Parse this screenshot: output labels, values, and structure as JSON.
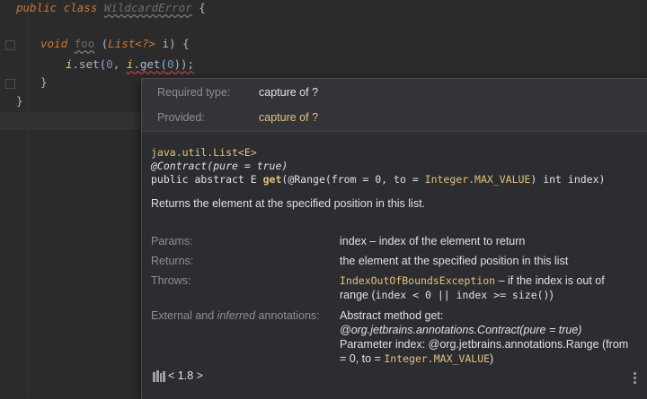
{
  "code": {
    "line1": {
      "kw_public": "public",
      "kw_class": "class",
      "class_name": "WildcardError",
      "brace": " {"
    },
    "line2": {
      "kw_void": "void",
      "method": "foo",
      "open": " (",
      "type": "List<?>",
      "param": " i) {"
    },
    "line3": {
      "var": "i",
      "call": ".set(",
      "n0": "0",
      "comma": ", ",
      "var2": "i",
      "get": ".get(",
      "n1": "0",
      "end": "));"
    },
    "line4": "}",
    "line5": "}"
  },
  "popup": {
    "required_label": "Required type:",
    "required_value": "capture of ?",
    "provided_label": "Provided:",
    "provided_value": "capture of ?",
    "sig_class": "java.util.List<E>",
    "sig_contract_prefix": "@Contract(pure = ",
    "sig_contract_value": "true",
    "sig_contract_suffix": ")",
    "sig_decl_prefix": "public abstract E ",
    "sig_method": "get",
    "sig_decl_mid": "(@Range(from = 0, to = ",
    "sig_max": "Integer.MAX_VALUE",
    "sig_decl_suffix": ") int index)",
    "description": "Returns the element at the specified position in this list.",
    "params_label": "Params:",
    "params_value": "index – index of the element to return",
    "returns_label": "Returns:",
    "returns_value": "the element at the specified position in this list",
    "throws_label": "Throws:",
    "throws_exception": "IndexOutOfBoundsException",
    "throws_text1": " – if the index is out of range (",
    "throws_code": "index < 0 || index >= size()",
    "throws_text2": ")",
    "ext_label_prefix": "External and ",
    "ext_label_italic": "inferred",
    "ext_label_suffix": " annotations:",
    "ext_line1_prefix": "Abstract method get: ",
    "ext_line1_italic": "@org.jetbrains.annotations.Contract(pure = true)",
    "ext_line2_prefix": "Parameter index: @org.jetbrains.annotations.Range (from = 0, to = ",
    "ext_line2_code": "Integer.MAX_VALUE",
    "ext_line2_suffix": ")",
    "sdk_label": "< 1.8 >",
    "icons": {
      "library": "library-icon",
      "more": "more-vertical-icon"
    }
  }
}
